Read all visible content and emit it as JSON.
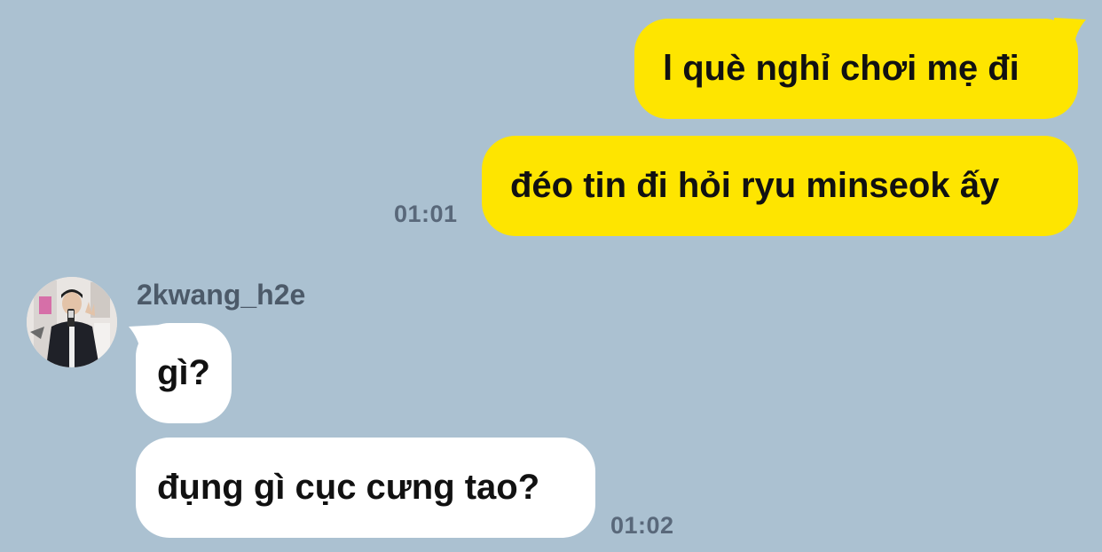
{
  "colors": {
    "background": "#abc1d1",
    "outgoing_bubble": "#fee500",
    "incoming_bubble": "#ffffff",
    "timestamp": "#59687a",
    "sender_name": "#4c5a69"
  },
  "messages": {
    "outgoing": [
      {
        "text": "l què nghỉ chơi mẹ đi"
      },
      {
        "text": "đéo tin đi hỏi ryu minseok ấy"
      }
    ],
    "outgoing_time": "01:01",
    "incoming_sender": "2kwang_h2e",
    "incoming": [
      {
        "text": "gì?"
      },
      {
        "text": "đụng gì cục cưng tao?"
      }
    ],
    "incoming_time": "01:02"
  },
  "icons": {
    "avatar": "profile-photo"
  }
}
